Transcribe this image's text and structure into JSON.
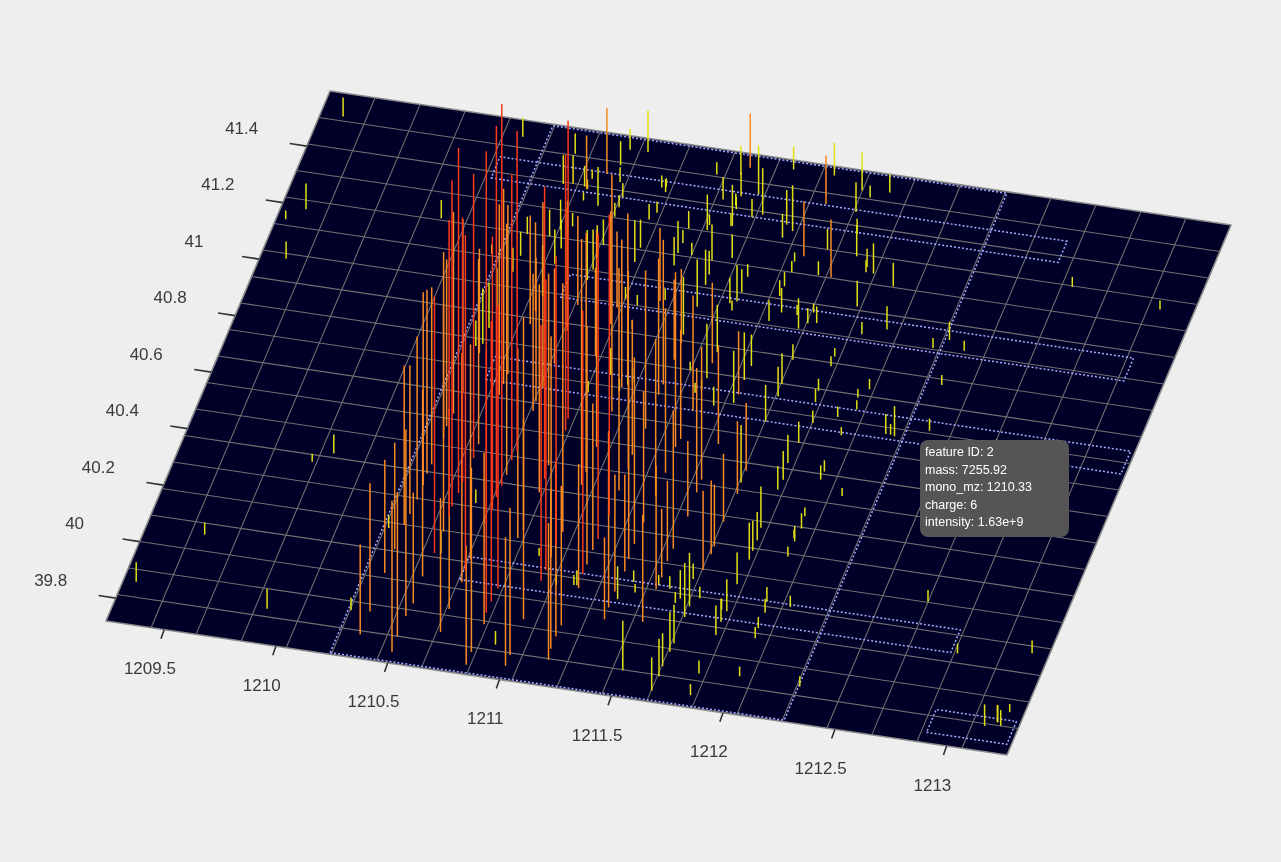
{
  "plot": {
    "rt_axis": {
      "tick_labels": [
        "41.4",
        "41.2",
        "41",
        "40.8",
        "40.6",
        "40.4",
        "40.2",
        "40",
        "39.8"
      ]
    },
    "mz_axis": {
      "tick_labels": [
        "1209.5",
        "1210",
        "1210.5",
        "1211",
        "1211.5",
        "1212",
        "1212.5",
        "1213"
      ]
    }
  },
  "tooltip": {
    "lines": [
      "feature ID: 2",
      "mass: 7255.92",
      "mono_mz: 1210.33",
      "charge: 6",
      "intensity: 1.63e+9"
    ]
  }
}
